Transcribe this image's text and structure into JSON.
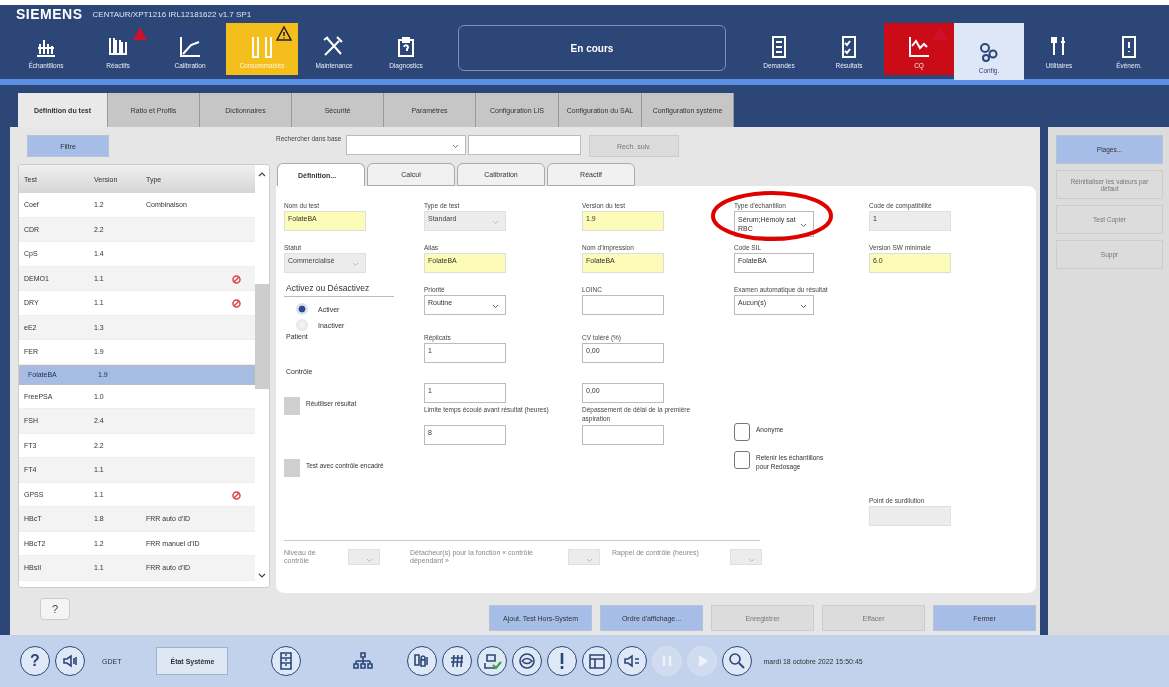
{
  "header": {
    "brand": "SIEMENS",
    "subtitle": "CENTAUR/XPT1216 IRL12181622 v1.7 SP1"
  },
  "nav": {
    "left": [
      {
        "label": "Échantillons",
        "selected": false
      },
      {
        "label": "Réactifs",
        "selected": false,
        "alert": true
      },
      {
        "label": "Calibration",
        "selected": false
      },
      {
        "label": "Consommables",
        "selected": false,
        "warning": true
      },
      {
        "label": "Maintenance",
        "selected": false
      },
      {
        "label": "Diagnostics",
        "selected": false
      }
    ],
    "status": "En cours",
    "right": [
      {
        "label": "Demandes",
        "selected": false
      },
      {
        "label": "Résultats",
        "selected": false
      },
      {
        "label": "CQ",
        "selected": false,
        "error": true,
        "alert": true
      },
      {
        "label": "Config.",
        "selected": true
      },
      {
        "label": "Utilitaires",
        "selected": false
      },
      {
        "label": "Événem.",
        "selected": false
      }
    ]
  },
  "tabs": [
    {
      "label": "Définition du test",
      "selected": true
    },
    {
      "label": "Ratio et Profils",
      "selected": false
    },
    {
      "label": "Dictionnaires",
      "selected": false
    },
    {
      "label": "Sécurité",
      "selected": false
    },
    {
      "label": "Paramètres",
      "selected": false
    },
    {
      "label": "Configuration LIS",
      "selected": false
    },
    {
      "label": "Configuration du SAL",
      "selected": false
    },
    {
      "label": "Configuration système",
      "selected": false
    }
  ],
  "filter_button": "Filtre",
  "table": {
    "columns": [
      "Test",
      "Version",
      "Type"
    ],
    "rows": [
      {
        "test": "Coef",
        "version": "1.2",
        "type": "Combinaison",
        "blocked": false,
        "selected": false
      },
      {
        "test": "CDR",
        "version": "2.2",
        "blocked": false,
        "selected": false
      },
      {
        "test": "CpS",
        "version": "1.4",
        "blocked": false,
        "selected": false
      },
      {
        "test": "DEMO1",
        "version": "1.1",
        "blocked": true,
        "selected": false
      },
      {
        "test": "DRY",
        "version": "1.1",
        "blocked": true,
        "selected": false
      },
      {
        "test": "eE2",
        "version": "1.3",
        "blocked": false,
        "selected": false
      },
      {
        "test": "FER",
        "version": "1.9",
        "blocked": false,
        "selected": false
      },
      {
        "test": "FolateBA",
        "version": "1.9",
        "blocked": false,
        "selected": true
      },
      {
        "test": "FreePSA",
        "version": "1.0",
        "blocked": false,
        "selected": false
      },
      {
        "test": "FSH",
        "version": "2.4",
        "blocked": false,
        "selected": false
      },
      {
        "test": "FT3",
        "version": "2.2",
        "blocked": false,
        "selected": false
      },
      {
        "test": "FT4",
        "version": "1.1",
        "blocked": false,
        "selected": false
      },
      {
        "test": "GPSS",
        "version": "1.1",
        "blocked": true,
        "selected": false
      },
      {
        "test": "HBcT",
        "version": "1.8",
        "type": "FRR auto d'ID",
        "blocked": false,
        "selected": false
      },
      {
        "test": "HBcT2",
        "version": "1.2",
        "type": "FRR manuel d'ID",
        "blocked": false,
        "selected": false
      },
      {
        "test": "HBsII",
        "version": "1.1",
        "type": "FRR auto d'ID",
        "blocked": false,
        "selected": false
      }
    ]
  },
  "help_button": "?",
  "search": {
    "label": "Rechercher dans base",
    "button": "Rech. suiv."
  },
  "form": {
    "tabs": [
      {
        "label": "Définition...",
        "selected": true
      },
      {
        "label": "Calcul",
        "selected": false
      },
      {
        "label": "Calibration",
        "selected": false
      },
      {
        "label": "Réactif",
        "selected": false
      }
    ],
    "columns": [
      [
        {
          "kind": "field",
          "label": "Nom du test",
          "value": "FolateBA",
          "highlighted": true,
          "disabled": false
        },
        {
          "kind": "select",
          "label": "Statut",
          "value": "Commercialisé",
          "disabled": true
        },
        {
          "kind": "heading",
          "label": "Activez ou Désactivez"
        },
        {
          "kind": "radio",
          "label": "Activer",
          "selected": true
        },
        {
          "kind": "radio",
          "label": "Inactiver",
          "selected": false
        },
        {
          "kind": "text",
          "label": "Patient"
        },
        {
          "kind": "text",
          "label": "Contrôle"
        },
        {
          "kind": "checkbox",
          "label": "Réutiliser résultat",
          "checked": false,
          "disabled": true
        },
        {
          "kind": "checkbox",
          "label": "Test avec contrôle encadré",
          "checked": false,
          "disabled": true
        }
      ],
      [
        {
          "kind": "select",
          "label": "Type de test",
          "value": "Standard",
          "disabled": true
        },
        {
          "kind": "field",
          "label": "Alias",
          "value": "FolateBA",
          "highlighted": true,
          "disabled": false
        },
        {
          "kind": "select",
          "label": "Priorité",
          "value": "Routine",
          "disabled": false
        },
        {
          "kind": "field",
          "label": "Réplicats",
          "value": "1",
          "highlighted": false,
          "disabled": false
        },
        {
          "kind": "field",
          "value": "1",
          "highlighted": false,
          "disabled": false
        },
        {
          "kind": "field",
          "label": "Limite temps écoulé avant résultat (heures)",
          "value": "8",
          "highlighted": false,
          "disabled": false
        }
      ],
      [
        {
          "kind": "field",
          "label": "Version du test",
          "value": "1.9",
          "highlighted": true,
          "disabled": false
        },
        {
          "kind": "field",
          "label": "Nom d'impression",
          "value": "FolateBA",
          "highlighted": true,
          "disabled": false
        },
        {
          "kind": "field",
          "label": "LOINC",
          "highlighted": false,
          "disabled": false
        },
        {
          "kind": "field",
          "label": "CV toléré (%)",
          "value": "0,00",
          "highlighted": false,
          "disabled": false
        },
        {
          "kind": "field",
          "value": "0,00",
          "highlighted": false,
          "disabled": false
        },
        {
          "kind": "field",
          "label": "Dépassement de délai de la première aspiration",
          "highlighted": false,
          "disabled": false
        }
      ],
      [
        {
          "kind": "select",
          "label": "Type d'échantillon",
          "value": "Sérum;Hémoly sat RBC",
          "disabled": false
        },
        {
          "kind": "field",
          "label": "Code SIL",
          "value": "FolateBA",
          "highlighted": false,
          "disabled": false
        },
        {
          "kind": "select",
          "label": "Examen automatique du résultat",
          "value": "Aucun(s)",
          "disabled": false
        },
        {
          "kind": "checkbox",
          "label": "Anonyme",
          "checked": false,
          "disabled": false
        },
        {
          "kind": "checkbox",
          "label": "Retenir les échantillons pour Redosage",
          "checked": false,
          "disabled": false
        }
      ],
      [
        {
          "kind": "field",
          "label": "Code de compatibilité",
          "value": "1",
          "highlighted": false,
          "disabled": true
        },
        {
          "kind": "field",
          "label": "Version SW minimale",
          "value": "6.0",
          "highlighted": true,
          "disabled": false
        },
        {
          "kind": "field",
          "label": "Point de surdilution",
          "highlighted": false,
          "disabled": true
        }
      ]
    ],
    "control_row": [
      {
        "label": "Niveau de contrôle",
        "disabled": true
      },
      {
        "label": "Détacheur(s) pour la fonction « contrôle dépendant »",
        "disabled": true
      },
      {
        "label": "Rappel de contrôle (heures)",
        "disabled": true
      }
    ],
    "annotation_ellipse": true
  },
  "actions": [
    {
      "label": "Ajout. Test Hors-System",
      "disabled": false
    },
    {
      "label": "Ordre d'affichage...",
      "disabled": false
    },
    {
      "label": "Enregistrer",
      "disabled": true
    },
    {
      "label": "Effacer",
      "disabled": true
    },
    {
      "label": "Fermer",
      "disabled": false
    }
  ],
  "side_buttons": [
    {
      "label": "Plages...",
      "disabled": false
    },
    {
      "label": "Réinitialiser les valeurs par défaut",
      "disabled": true
    },
    {
      "label": "Test Copier",
      "disabled": true
    },
    {
      "label": "Suppr",
      "disabled": true
    }
  ],
  "status_bar": {
    "user": "GDET",
    "system_button": "État Système",
    "tools": [
      {
        "disabled": false
      },
      {
        "disabled": false
      },
      {
        "disabled": false
      },
      {
        "disabled": false
      },
      {
        "disabled": false
      },
      {
        "disabled": false
      },
      {
        "disabled": false
      },
      {
        "disabled": false
      },
      {
        "disabled": false
      },
      {
        "disabled": true
      },
      {
        "disabled": true
      },
      {
        "disabled": false
      }
    ],
    "datetime": "mardi 18 octobre 2022 15:50:45"
  }
}
